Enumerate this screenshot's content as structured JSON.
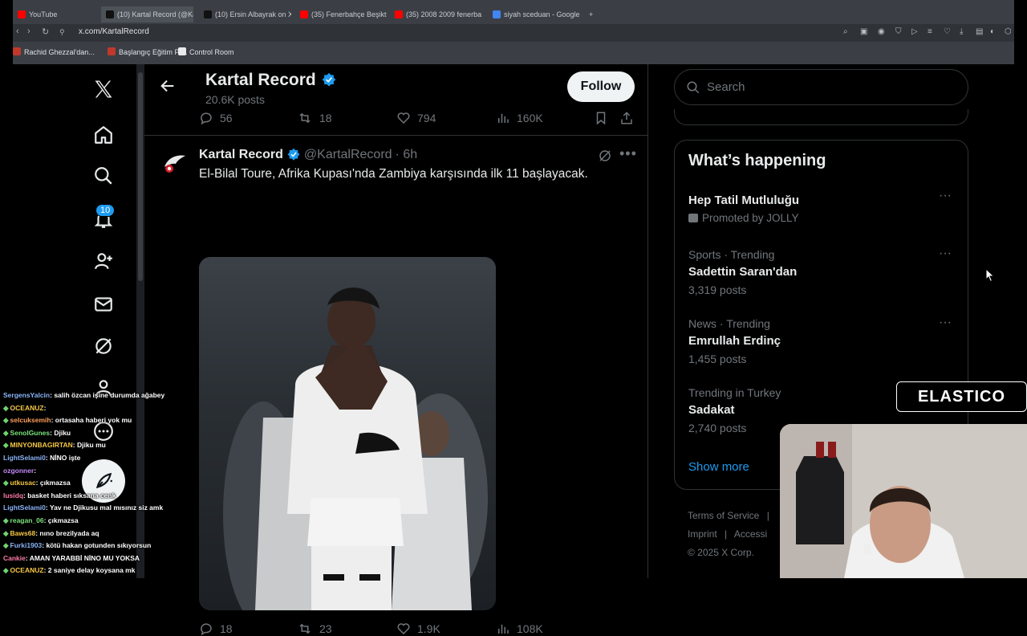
{
  "browser": {
    "tabs": [
      {
        "label": "YouTube",
        "color": "#ff0000"
      },
      {
        "label": "(10) Kartal Record (@Ka",
        "color": "#111111"
      },
      {
        "label": "(10) Ersin Albayrak on X",
        "color": "#111111"
      },
      {
        "label": "(35) Fenerbahçe Beşikt",
        "color": "#ff0000"
      },
      {
        "label": "(35) 2008 2009 fenerba",
        "color": "#ff0000"
      },
      {
        "label": "siyah sceduan - Google",
        "color": "#4285f4"
      }
    ],
    "url": "x.com/KartalRecord",
    "bookmarks": [
      {
        "label": "Rachid Ghezzal'dan..."
      },
      {
        "label": "Başlangıç Eğitim Pr..."
      },
      {
        "label": "Control Room"
      }
    ]
  },
  "nav": {
    "notification_count": "10"
  },
  "profile_header": {
    "name": "Kartal Record",
    "posts_count": "20.6K posts",
    "follow_label": "Follow"
  },
  "prev_post_actions": {
    "replies": "56",
    "reposts": "18",
    "likes": "794",
    "views": "160K"
  },
  "post": {
    "author": "Kartal Record",
    "handle": "@KartalRecord",
    "time": "· 6h",
    "text": "El-Bilal Toure, Afrika Kupası'nda Zambiya karşısında ilk 11 başlayacak.",
    "replies": "18",
    "reposts": "23",
    "likes": "1.9K",
    "views": "108K"
  },
  "search": {
    "placeholder": "Search"
  },
  "trends": {
    "title": "What’s happening",
    "items": [
      {
        "context": "",
        "name": "Hep Tatil Mutluluğu",
        "meta": "Promoted by JOLLY"
      },
      {
        "context": "Sports · Trending",
        "name": "Sadettin Saran'dan",
        "meta": "3,319 posts"
      },
      {
        "context": "News · Trending",
        "name": "Emrullah Erdinç",
        "meta": "1,455 posts"
      },
      {
        "context": "Trending in Turkey",
        "name": "Sadakat",
        "meta": "2,740 posts"
      }
    ],
    "show_more": "Show more"
  },
  "footer": {
    "terms": "Terms of Service",
    "imprint": "Imprint",
    "accessibility": "Accessi",
    "copyright": "© 2025 X Corp."
  },
  "stream": {
    "brand": "ELASTICO",
    "chat": [
      {
        "user": "SergensYalcin",
        "msg": ": salih özcan işine durumda ağabey",
        "color": "#8ab4f8",
        "star": false
      },
      {
        "user": "OCEANUZ",
        "msg": ": ",
        "color": "#f6c744",
        "star": true
      },
      {
        "user": "selcuksemih",
        "msg": ": ortasaha haberi yok mu",
        "color": "#ff9d5c",
        "star": true
      },
      {
        "user": "SenolGunes",
        "msg": ": Djiku",
        "color": "#7be37b",
        "star": true
      },
      {
        "user": "MINYONBAGIRTAN",
        "msg": ": Djiku mu",
        "color": "#f6c744",
        "star": true
      },
      {
        "user": "LightSelami0",
        "msg": ": NİNO işte",
        "color": "#8ab4f8",
        "star": false
      },
      {
        "user": "ozgonner",
        "msg": ": ",
        "color": "#c58af9",
        "star": false
      },
      {
        "user": "utkusac",
        "msg": ": çıkmazsa",
        "color": "#f6c744",
        "star": true
      },
      {
        "user": "lusidq",
        "msg": ": basket haberi sıksana cenk",
        "color": "#ff7aa8",
        "star": false
      },
      {
        "user": "LightSelami0",
        "msg": ": Yav ne Djikusu mal mısınız siz amk",
        "color": "#8ab4f8",
        "star": false
      },
      {
        "user": "reagan_06",
        "msg": ": çıkmazsa",
        "color": "#7be37b",
        "star": true
      },
      {
        "user": "Baws68",
        "msg": ": nıno brezilyada aq",
        "color": "#f6c744",
        "star": true
      },
      {
        "user": "Furki1903",
        "msg": ": kötü hakan gotunden sıkıyorsun",
        "color": "#8ab4f8",
        "star": true
      },
      {
        "user": "Cankie",
        "msg": ": AMAN YARABBİ NİNO MU YOKSA",
        "color": "#ff7aa8",
        "star": false
      },
      {
        "user": "OCEANUZ",
        "msg": ": 2 saniye delay koysana mk",
        "color": "#f6c744",
        "star": true
      }
    ]
  }
}
